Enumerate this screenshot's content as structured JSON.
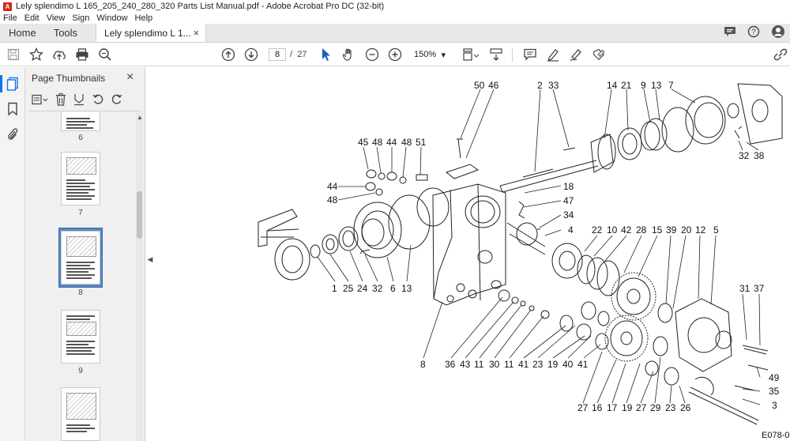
{
  "window": {
    "title": "Lely splendimo L 165_205_240_280_320 Parts List Manual.pdf - Adobe Acrobat Pro DC (32-bit)",
    "app_icon_text": "A"
  },
  "menu": [
    "File",
    "Edit",
    "View",
    "Sign",
    "Window",
    "Help"
  ],
  "tabs": {
    "home": "Home",
    "tools": "Tools",
    "document": "Lely splendimo L 1...",
    "close": "×"
  },
  "toolbar": {
    "current_page": "8",
    "page_separator": "/",
    "total_pages": "27",
    "zoom": "150%",
    "zoom_caret": "▾"
  },
  "panel": {
    "title": "Page Thumbnails",
    "close": "×",
    "thumbnails": [
      {
        "label": "6"
      },
      {
        "label": "7"
      },
      {
        "label": "8",
        "selected": true
      },
      {
        "label": "9"
      },
      {
        "label": ""
      }
    ]
  },
  "diagram": {
    "page_code": "E078-0",
    "callouts_top": [
      "50",
      "46",
      "2",
      "33",
      "14",
      "21",
      "9",
      "13",
      "7"
    ],
    "callouts_left_top": [
      "45",
      "48",
      "44",
      "48",
      "51"
    ],
    "callouts_left_mid": [
      "44",
      "48"
    ],
    "callouts_right_mid": [
      "18",
      "47",
      "34",
      "4"
    ],
    "callouts_right_top": [
      "32",
      "38"
    ],
    "callouts_row2": [
      "22",
      "10",
      "42",
      "28",
      "15",
      "39",
      "20",
      "12",
      "5"
    ],
    "callouts_left_bottom": [
      "1",
      "25",
      "24",
      "32",
      "6",
      "13"
    ],
    "callouts_bottom": [
      "8",
      "36",
      "43",
      "11",
      "30",
      "11",
      "41",
      "23",
      "19",
      "40",
      "41"
    ],
    "callouts_right": [
      "31",
      "37",
      "49",
      "35",
      "3"
    ],
    "callouts_lower": [
      "27",
      "16",
      "17",
      "19",
      "27",
      "29",
      "23",
      "26"
    ]
  }
}
